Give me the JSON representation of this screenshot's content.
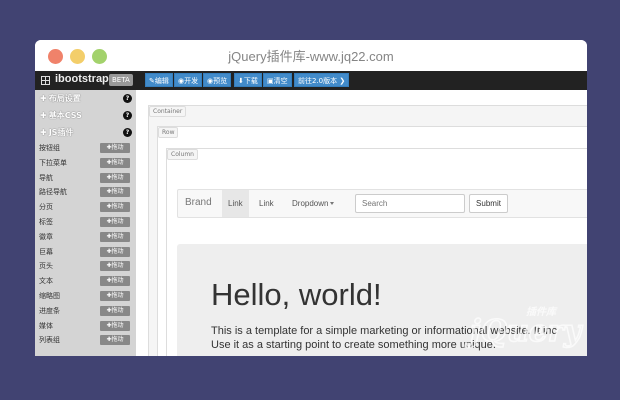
{
  "window": {
    "title": "jQuery插件库-www.jq22.com"
  },
  "navbar": {
    "brand": "ibootstrap",
    "beta": "BETA",
    "buttons": [
      {
        "icon": "✎",
        "label": "编辑"
      },
      {
        "icon": "◉",
        "label": "开发"
      },
      {
        "icon": "◉",
        "label": "预览"
      },
      {
        "icon": "⬇",
        "label": "下载"
      },
      {
        "icon": "▣",
        "label": "清空"
      },
      {
        "icon": "",
        "label": "前往2.0版本 ❯"
      }
    ]
  },
  "sidebar": {
    "sections": [
      {
        "label": "布局设置"
      },
      {
        "label": "基本CSS"
      },
      {
        "label": "JS插件"
      }
    ],
    "drag_label": "拖动",
    "items": [
      "按钮组",
      "下拉菜单",
      "导航",
      "路径导航",
      "分页",
      "标签",
      "徽章",
      "巨幕",
      "页头",
      "文本",
      "缩略图",
      "进度条",
      "媒体",
      "列表组"
    ]
  },
  "canvas": {
    "tags": {
      "container": "Container",
      "row": "Row",
      "column": "Column"
    },
    "navbar": {
      "brand": "Brand",
      "link_active": "Link",
      "link": "Link",
      "dropdown": "Dropdown",
      "search_placeholder": "Search",
      "submit": "Submit"
    },
    "jumbotron": {
      "heading": "Hello, world!",
      "line1": "This is a template for a simple marketing or informational website. It inc",
      "line2": "Use it as a starting point to create something more unique."
    }
  },
  "watermark": {
    "cn": "插件库",
    "brand": "jQuery"
  },
  "colors": {
    "background": "#414372",
    "toolbar_btn": "#428bca",
    "navbar": "#222222",
    "sidebar": "#d4d4d4"
  }
}
